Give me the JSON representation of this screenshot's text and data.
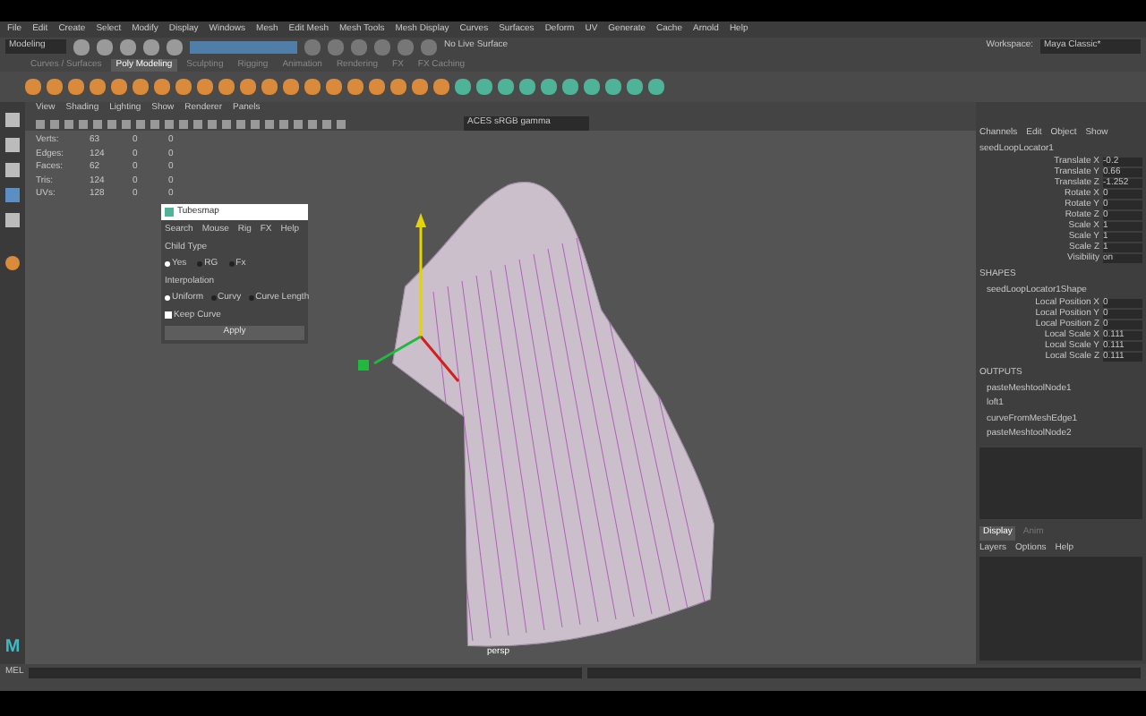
{
  "menu_bar": [
    "File",
    "Edit",
    "Create",
    "Select",
    "Modify",
    "Display",
    "Windows",
    "Mesh",
    "Edit Mesh",
    "Mesh Tools",
    "Mesh Display",
    "Curves",
    "Surfaces",
    "Deform",
    "UV",
    "Generate",
    "Cache",
    "Arnold",
    "Help"
  ],
  "status_line": {
    "mode": "Modeling",
    "symmetry": "No Live Surface",
    "workspace_label": "Workspace:",
    "workspace": "Maya Classic*"
  },
  "shelf_tabs": [
    {
      "label": "Curves / Surfaces",
      "selected": false
    },
    {
      "label": "Poly Modeling",
      "selected": true
    },
    {
      "label": "Sculpting",
      "selected": false
    },
    {
      "label": "Rigging",
      "selected": false
    },
    {
      "label": "Animation",
      "selected": false
    },
    {
      "label": "Rendering",
      "selected": false
    },
    {
      "label": "FX",
      "selected": false
    },
    {
      "label": "FX Caching",
      "selected": false
    }
  ],
  "panel_menu": [
    "View",
    "Shading",
    "Lighting",
    "Show",
    "Renderer",
    "Panels"
  ],
  "camera_field": "ACES sRGB gamma",
  "hud": [
    {
      "label": "Verts:",
      "c1": "63",
      "c2": "0",
      "c3": "0"
    },
    {
      "label": "Edges:",
      "c1": "124",
      "c2": "0",
      "c3": "0"
    },
    {
      "label": "Faces:",
      "c1": "62",
      "c2": "0",
      "c3": "0"
    },
    {
      "label": "Tris:",
      "c1": "124",
      "c2": "0",
      "c3": "0"
    },
    {
      "label": "UVs:",
      "c1": "128",
      "c2": "0",
      "c3": "0"
    }
  ],
  "dialog": {
    "title": "Tubesmap",
    "menus": [
      "Search",
      "Mouse",
      "Rig",
      "FX",
      "Help"
    ],
    "section1": "Child Type",
    "types": [
      {
        "label": "Yes",
        "selected": true
      },
      {
        "label": "RG",
        "selected": false
      },
      {
        "label": "Fx",
        "selected": false
      }
    ],
    "section2": "Interpolation",
    "interp": [
      {
        "label": "Uniform",
        "selected": true
      },
      {
        "label": "Curvy",
        "selected": false
      },
      {
        "label": "Curve Length",
        "selected": false
      }
    ],
    "keep_curve": {
      "label": "Keep Curve",
      "checked": true
    },
    "apply": "Apply"
  },
  "viewport_label": "persp",
  "channel_box": {
    "menus": [
      "Channels",
      "Edit",
      "Object",
      "Show"
    ],
    "object": "seedLoopLocator1",
    "channels": [
      {
        "name": "Translate X",
        "value": "-0.2"
      },
      {
        "name": "Translate Y",
        "value": "0.66"
      },
      {
        "name": "Translate Z",
        "value": "-1.252"
      },
      {
        "name": "Rotate X",
        "value": "0"
      },
      {
        "name": "Rotate Y",
        "value": "0"
      },
      {
        "name": "Rotate Z",
        "value": "0"
      },
      {
        "name": "Scale X",
        "value": "1"
      },
      {
        "name": "Scale Y",
        "value": "1"
      },
      {
        "name": "Scale Z",
        "value": "1"
      },
      {
        "name": "Visibility",
        "value": "on"
      }
    ],
    "shapes_header": "SHAPES",
    "shape": "seedLoopLocator1Shape",
    "shape_channels": [
      {
        "name": "Local Position X",
        "value": "0"
      },
      {
        "name": "Local Position Y",
        "value": "0"
      },
      {
        "name": "Local Position Z",
        "value": "0"
      },
      {
        "name": "Local Scale X",
        "value": "0.111"
      },
      {
        "name": "Local Scale Y",
        "value": "0.111"
      },
      {
        "name": "Local Scale Z",
        "value": "0.111"
      }
    ],
    "outputs_header": "OUTPUTS",
    "outputs": [
      "pasteMeshtoolNode1",
      "loft1",
      "curveFromMeshEdge1",
      "pasteMeshtoolNode2"
    ]
  },
  "layer_tabs": [
    {
      "label": "Display",
      "selected": true
    },
    {
      "label": "Anim",
      "selected": false
    }
  ],
  "layer_menus": [
    "Layers",
    "Options",
    "Help"
  ],
  "command_lang": "MEL",
  "logo": "M"
}
